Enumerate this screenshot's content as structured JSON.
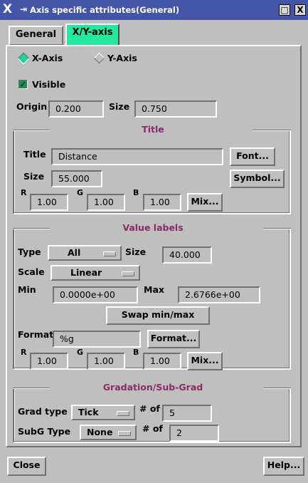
{
  "window": {
    "title": "Axis specific attributes(General)",
    "logo": "X",
    "pin_glyph": "⇥",
    "btn_max": "□",
    "btn_close": "X"
  },
  "tabs": {
    "general": "General",
    "xy": "X/Y-axis"
  },
  "axis": {
    "x_label": "X-Axis",
    "y_label": "Y-Axis"
  },
  "visible": {
    "label": "Visible"
  },
  "origin": {
    "label": "Origin",
    "value": "0.200"
  },
  "size": {
    "label": "Size",
    "value": "0.750"
  },
  "title_group": {
    "title": "Title",
    "title_label": "Title",
    "title_value": "Distance",
    "font_btn": "Font...",
    "size_label": "Size",
    "size_value": "55.000",
    "symbol_btn": "Symbol...",
    "r_label": "R",
    "r_value": "1.00",
    "g_label": "G",
    "g_value": "1.00",
    "b_label": "B",
    "b_value": "1.00",
    "mix_btn": "Mix..."
  },
  "value_labels": {
    "title": "Value labels",
    "type_label": "Type",
    "type_value": "All",
    "size_label": "Size",
    "size_value": "40.000",
    "scale_label": "Scale",
    "scale_value": "Linear",
    "min_label": "Min",
    "min_value": "0.0000e+00",
    "max_label": "Max",
    "max_value": "2.6766e+00",
    "swap_btn": "Swap min/max",
    "format_label": "Format",
    "format_value": "%g",
    "format_btn": "Format...",
    "r_label": "R",
    "r_value": "1.00",
    "g_label": "G",
    "g_value": "1.00",
    "b_label": "B",
    "b_value": "1.00",
    "mix_btn": "Mix..."
  },
  "gradation": {
    "title": "Gradation/Sub-Grad",
    "grad_type_label": "Grad type",
    "grad_type_value": "Tick",
    "grad_num_label": "# of",
    "grad_num_value": "5",
    "subg_type_label": "SubG Type",
    "subg_type_value": "None",
    "subg_num_label": "# of",
    "subg_num_value": "2"
  },
  "footer": {
    "close_btn": "Close",
    "help_btn": "Help..."
  },
  "colors": {
    "titlebar": "#4455a8",
    "active_tab": "#22e8a0",
    "group_title": "#8b2a6a",
    "radio_selected": "#1fd0a0",
    "checkbox": "#1a8a5a"
  }
}
